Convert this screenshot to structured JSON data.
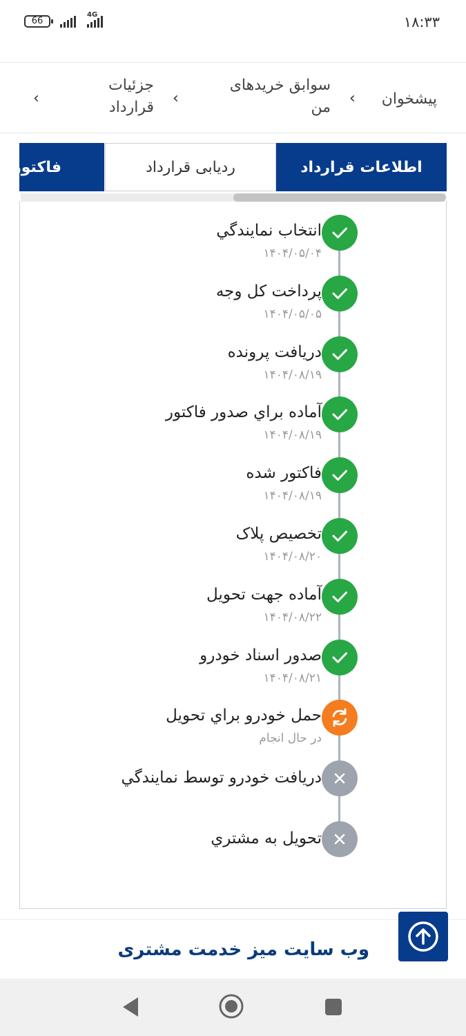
{
  "status_bar": {
    "time": "۱۸:۳۳",
    "battery": "66",
    "network": "4G"
  },
  "breadcrumb": {
    "items": [
      "پیشخوان",
      "سوابق خریدهای من",
      "جزئیات قرارداد"
    ],
    "line1_b": "سوابق خریدهای",
    "line2_b": "من",
    "line1_c": "جزئیات",
    "line2_c": "قرارداد"
  },
  "tabs": [
    {
      "label": "اطلاعات قرارداد",
      "active": true
    },
    {
      "label": "ردیابی قرارداد",
      "active": false
    },
    {
      "label": "فاکتور",
      "active": true
    }
  ],
  "steps": [
    {
      "title": "انتخاب نمایندگي",
      "date": "۱۴۰۴/۰۵/۰۴",
      "status": "done"
    },
    {
      "title": "پرداخت کل وجه",
      "date": "۱۴۰۴/۰۵/۰۵",
      "status": "done"
    },
    {
      "title": "دريافت پرونده",
      "date": "۱۴۰۴/۰۸/۱۹",
      "status": "done"
    },
    {
      "title": "آماده براي صدور فاکتور",
      "date": "۱۴۰۴/۰۸/۱۹",
      "status": "done"
    },
    {
      "title": "فاکتور شده",
      "date": "۱۴۰۴/۰۸/۱۹",
      "status": "done"
    },
    {
      "title": "تخصيص پلاک",
      "date": "۱۴۰۴/۰۸/۲۰",
      "status": "done"
    },
    {
      "title": "آماده جهت تحويل",
      "date": "۱۴۰۴/۰۸/۲۲",
      "status": "done"
    },
    {
      "title": "صدور اسناد خودرو",
      "date": "۱۴۰۴/۰۸/۲۱",
      "status": "done"
    },
    {
      "title": "حمل خودرو براي تحويل",
      "date": "در حال انجام",
      "status": "in-progress"
    },
    {
      "title": "دريافت خودرو توسط نمايندگي",
      "date": "",
      "status": "pending"
    },
    {
      "title": "تحويل به مشتري",
      "date": "",
      "status": "pending"
    }
  ],
  "footer": {
    "link": "وب سایت میز خدمت مشتری"
  },
  "colors": {
    "primary": "#073b8c",
    "done": "#28a745",
    "in_progress": "#f57c1f",
    "pending": "#9ea4ad"
  }
}
